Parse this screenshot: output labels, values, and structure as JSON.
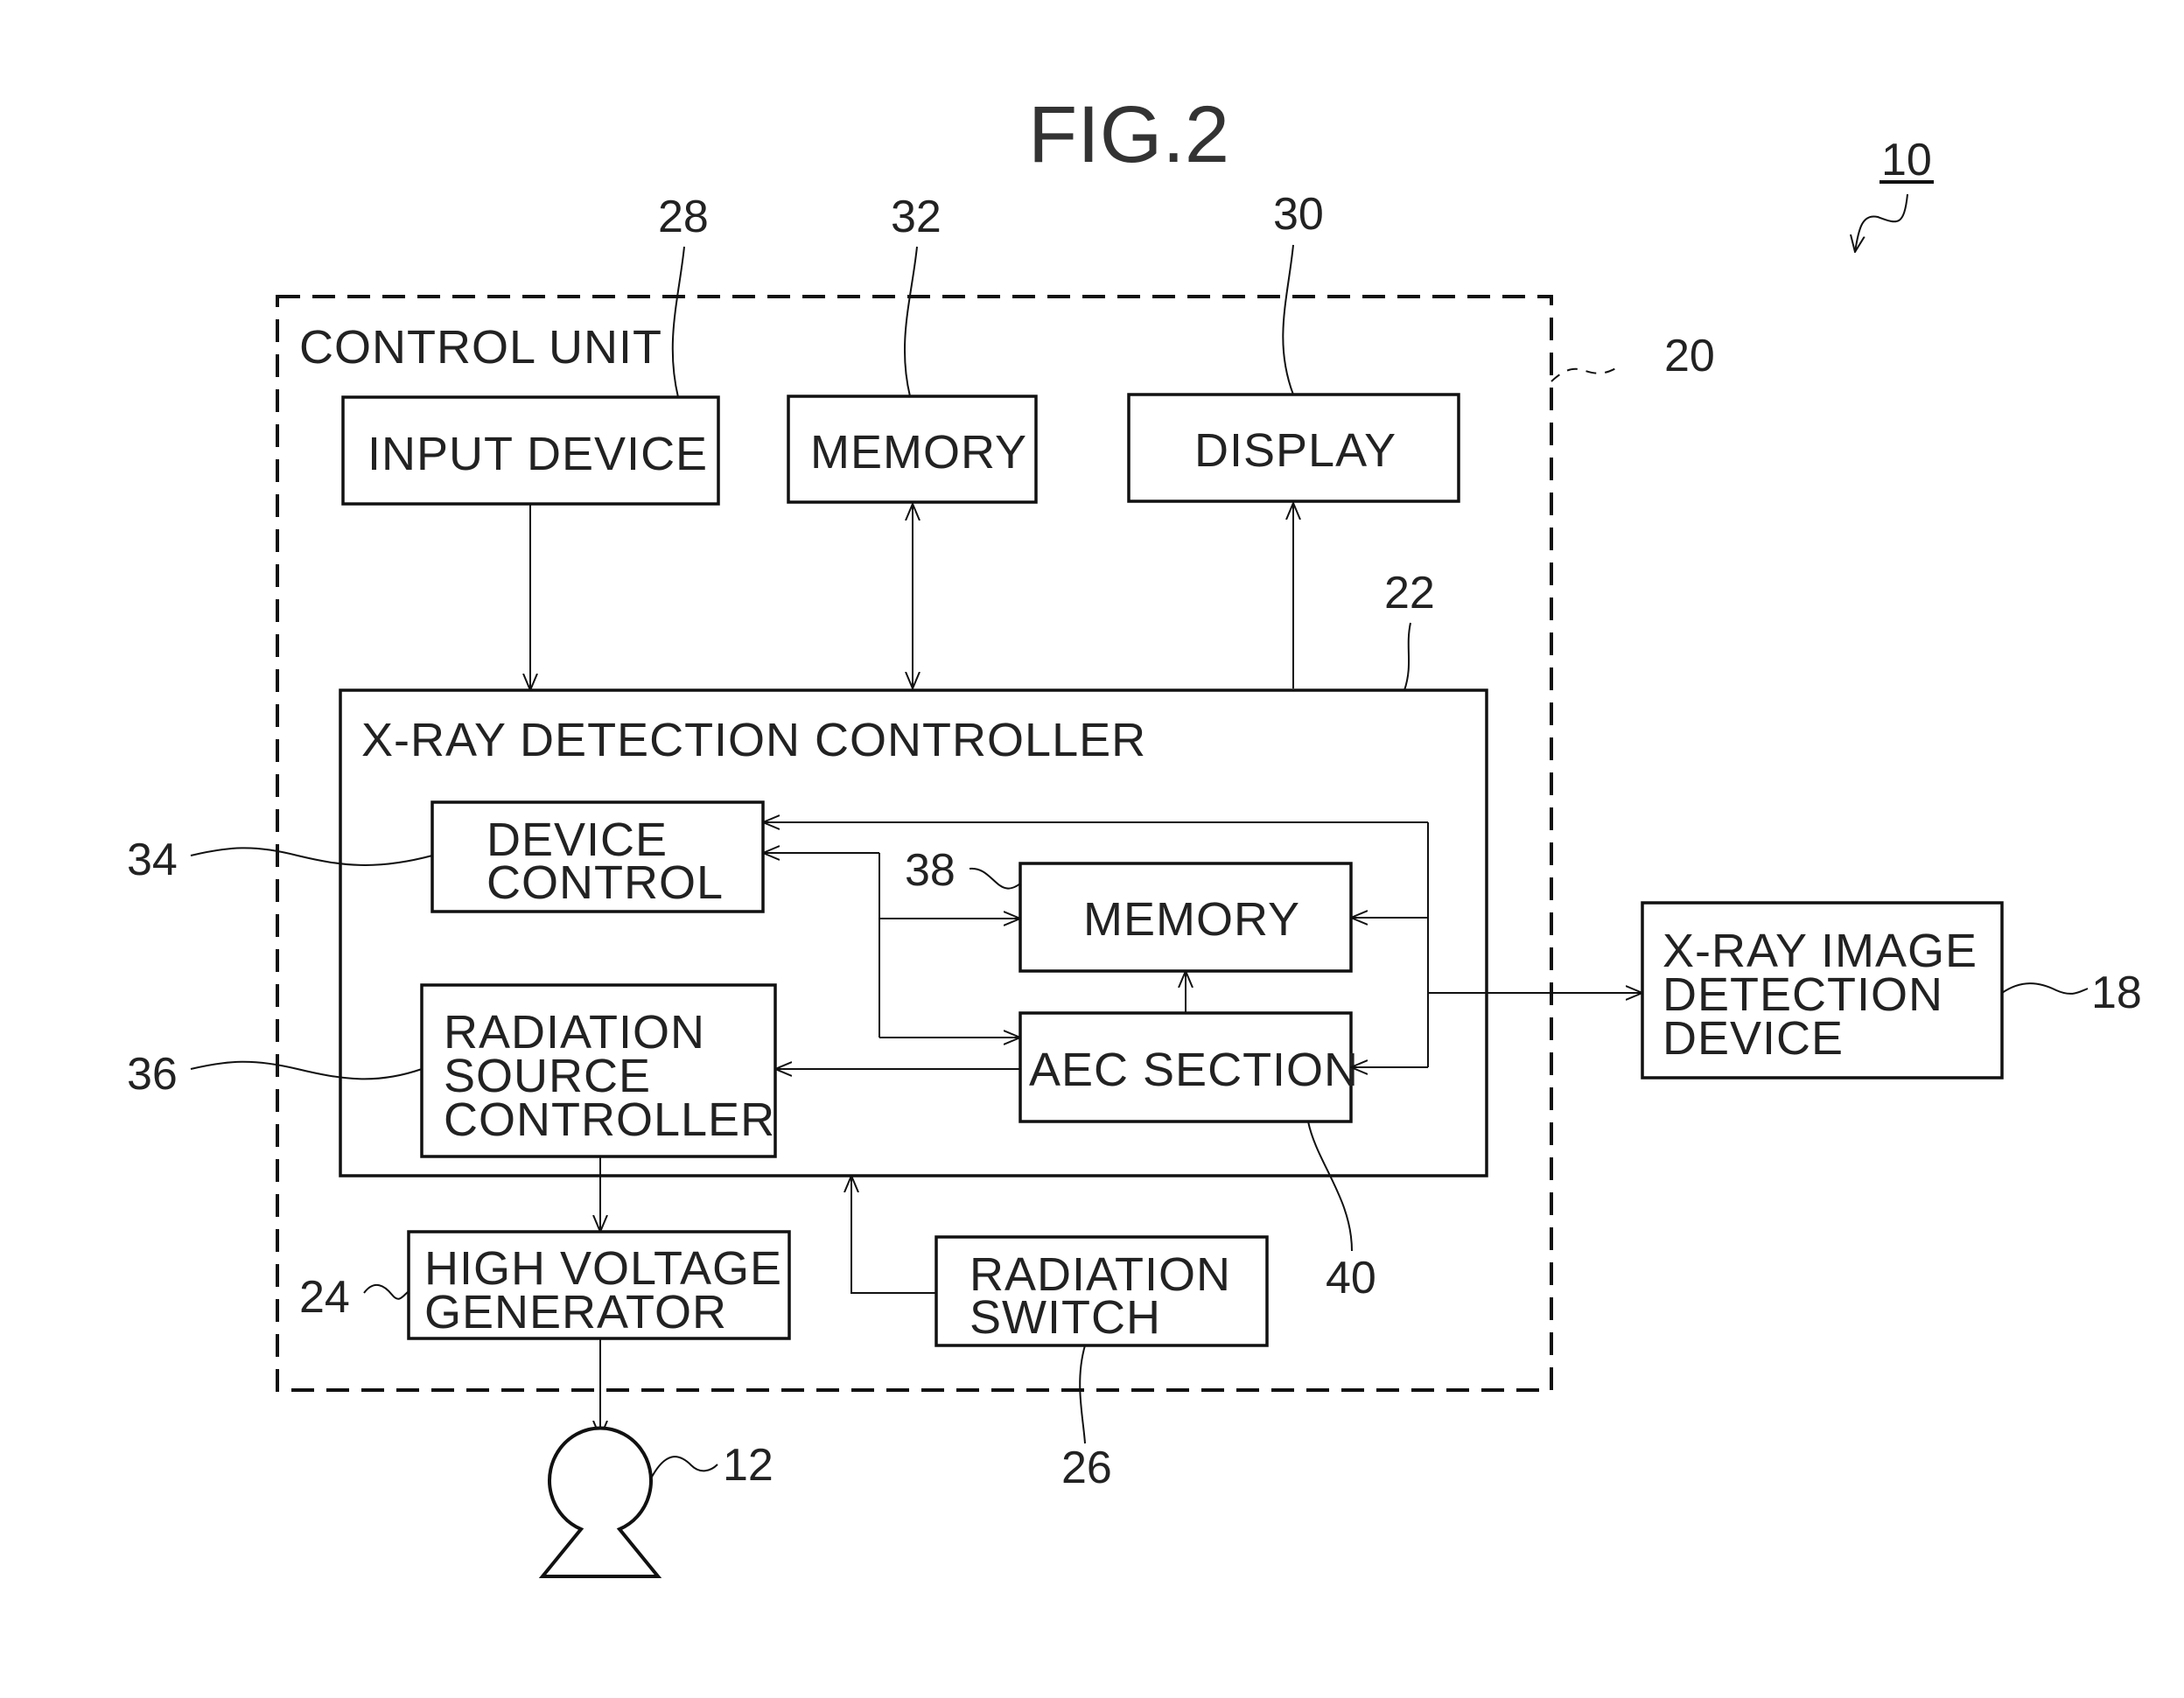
{
  "figure": {
    "title": "FIG.2",
    "system_ref": "10"
  },
  "control_unit": {
    "label": "CONTROL UNIT",
    "ref": "20",
    "input_device": {
      "label": "INPUT DEVICE",
      "ref": "28"
    },
    "memory": {
      "label": "MEMORY",
      "ref": "32"
    },
    "display": {
      "label": "DISPLAY",
      "ref": "30"
    },
    "xray_detection_controller": {
      "label": "X-RAY DETECTION CONTROLLER",
      "ref": "22",
      "device_control": {
        "lines": [
          "DEVICE",
          "CONTROL"
        ],
        "ref": "34"
      },
      "memory": {
        "label": "MEMORY",
        "ref": "38"
      },
      "radiation_source_controller": {
        "lines": [
          "RADIATION",
          "SOURCE",
          "CONTROLLER"
        ],
        "ref": "36"
      },
      "aec_section": {
        "label": "AEC SECTION",
        "ref": "40"
      }
    },
    "high_voltage_generator": {
      "lines": [
        "HIGH VOLTAGE",
        "GENERATOR"
      ],
      "ref": "24"
    },
    "radiation_switch": {
      "lines": [
        "RADIATION",
        "SWITCH"
      ],
      "ref": "26"
    }
  },
  "xray_image_detection_device": {
    "lines": [
      "X-RAY IMAGE",
      "DETECTION",
      "DEVICE"
    ],
    "ref": "18"
  },
  "xray_source": {
    "ref": "12"
  }
}
